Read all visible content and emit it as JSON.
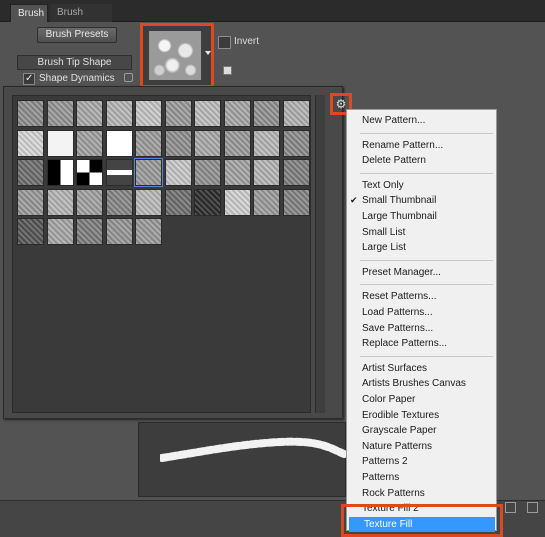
{
  "tabs": [
    {
      "label": "Brush",
      "active": true
    },
    {
      "label": "Brush Presets",
      "active": false
    }
  ],
  "brush_presets_button": "Brush Presets",
  "settings": {
    "brush_tip_shape": "Brush Tip Shape",
    "shape_dynamics": "Shape Dynamics",
    "shape_dynamics_checked": true
  },
  "invert": {
    "label": "Invert",
    "checked": false
  },
  "pattern_picker": {
    "gear_icon": "gear-icon",
    "swatch_tones": [
      [
        "#8d8d8d",
        "#959595",
        "#a9a9a9",
        "#b5b5b5",
        "#c6c6c6",
        "#9a9a9a",
        "#bcbcbc",
        "#a5a5a5",
        "#909090",
        "#b0b0b0"
      ],
      [
        "#d5d5d5",
        "#efefef",
        "#a0a0a0",
        "#f7f7f7",
        "#9c9c9c",
        "#8e8e8e",
        "#a8a8a8",
        "#9a9a9a",
        "#b6b6b6",
        "#8a8a8a"
      ],
      [
        "#6d6d6d",
        "#1a1a1a",
        "#bdbdbd",
        "#e8e8e8",
        "#9a9a9a",
        "#c7c7c7",
        "#8f8f8f",
        "#a3a3a3",
        "#b4b4b4",
        "#7f7f7f"
      ],
      [
        "#999999",
        "#b5b5b5",
        "#a0a0a0",
        "#858585",
        "#b8b8b8",
        "#6f6f6f",
        "#2c2c2c",
        "#cfcfcf",
        "#9b9b9b",
        "#838383"
      ],
      [
        "#555555",
        "#a6a6a6",
        "#7c7c7c",
        "#959595",
        "#9a9a9a"
      ]
    ],
    "selected": [
      2,
      4
    ]
  },
  "menu": {
    "items": [
      {
        "label": "New Pattern..."
      },
      {
        "sep": true
      },
      {
        "label": "Rename Pattern..."
      },
      {
        "label": "Delete Pattern"
      },
      {
        "sep": true
      },
      {
        "label": "Text Only"
      },
      {
        "label": "Small Thumbnail",
        "checked": true
      },
      {
        "label": "Large Thumbnail"
      },
      {
        "label": "Small List"
      },
      {
        "label": "Large List"
      },
      {
        "sep": true
      },
      {
        "label": "Preset Manager..."
      },
      {
        "sep": true
      },
      {
        "label": "Reset Patterns..."
      },
      {
        "label": "Load Patterns..."
      },
      {
        "label": "Save Patterns..."
      },
      {
        "label": "Replace Patterns..."
      },
      {
        "sep": true
      },
      {
        "label": "Artist Surfaces"
      },
      {
        "label": "Artists Brushes Canvas"
      },
      {
        "label": "Color Paper"
      },
      {
        "label": "Erodible Textures"
      },
      {
        "label": "Grayscale Paper"
      },
      {
        "label": "Nature Patterns"
      },
      {
        "label": "Patterns 2"
      },
      {
        "label": "Patterns"
      },
      {
        "label": "Rock Patterns"
      },
      {
        "label": "Texture Fill 2"
      },
      {
        "label": "Texture Fill",
        "highlighted": true
      }
    ]
  },
  "colors": {
    "highlight_frame": "#e0481e",
    "menu_highlight": "#3399ff",
    "panel_bg": "#535353"
  }
}
